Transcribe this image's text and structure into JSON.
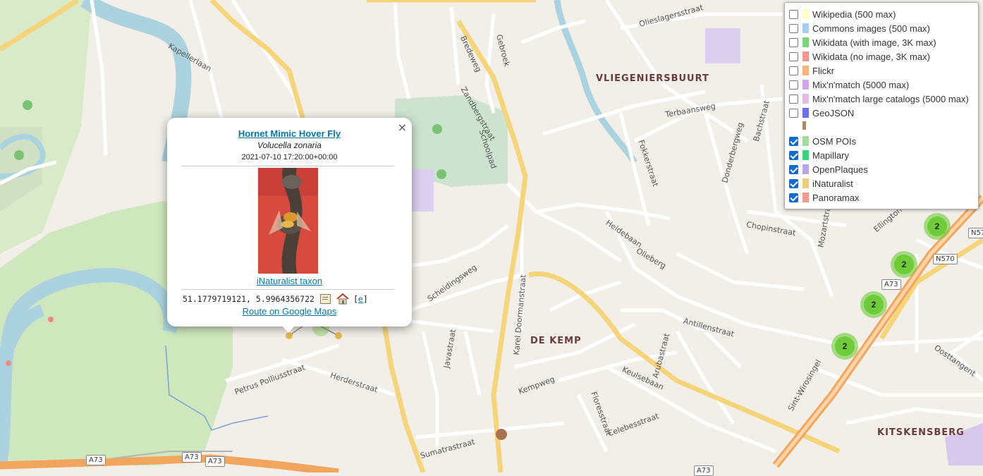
{
  "map": {
    "districts": [
      "VLIEGENIERSBUURT",
      "DE KEMP",
      "KITSKENSBERG"
    ],
    "streets": [
      "Kapellerlaan",
      "Bredeweg",
      "Gebroek",
      "Zandbergstraat",
      "Schoolpad",
      "Olieslagersstraat",
      "Terbaansweg",
      "Fokkerstraat",
      "Donderbergweg",
      "Bachstraat",
      "Heidebaan",
      "Olieberg",
      "Chopinstraat",
      "Mozartstraat",
      "Ellington",
      "Scheidingsweg",
      "Karel Doormanstraat",
      "Javastraat",
      "Antillenstraat",
      "Arubastraat",
      "Kempweg",
      "Keulsebaan",
      "Floresstraat",
      "Celebesstraat",
      "Sumatrastraat",
      "Petrus Polliusstraat",
      "Herderstraat",
      "Sint-Wirosingel",
      "Oosttangent"
    ],
    "road_shields": [
      "A73",
      "A73",
      "A73",
      "A73",
      "A73",
      "N570",
      "N57"
    ],
    "clusters": [
      "2",
      "2",
      "2",
      "2"
    ]
  },
  "layers": [
    {
      "label": "Wikipedia (500 max)",
      "checked": false,
      "color": "#ffffcc"
    },
    {
      "label": "Commons images (500 max)",
      "checked": false,
      "color": "#a9cdf5"
    },
    {
      "label": "Wikidata (with image, 3K max)",
      "checked": false,
      "color": "#7ed37c"
    },
    {
      "label": "Wikidata (no image, 3K max)",
      "checked": false,
      "color": "#f39591"
    },
    {
      "label": "Flickr",
      "checked": false,
      "color": "#f5b57c"
    },
    {
      "label": "Mix'n'match (5000 max)",
      "checked": false,
      "color": "#cfa7ea"
    },
    {
      "label": "Mix'n'match large catalogs (5000 max)",
      "checked": false,
      "color": "#e2bce0"
    },
    {
      "label": "GeoJSON",
      "checked": false,
      "color": "#6f6ff5"
    },
    {
      "label": "OSM POIs",
      "checked": true,
      "color": "#a3d9a3"
    },
    {
      "label": "Mapillary",
      "checked": true,
      "color": "#3bd27a"
    },
    {
      "label": "OpenPlaques",
      "checked": true,
      "color": "#b8a6e6"
    },
    {
      "label": "iNaturalist",
      "checked": true,
      "color": "#e9cc7c"
    },
    {
      "label": "Panoramax",
      "checked": true,
      "color": "#f19a8e"
    }
  ],
  "popup": {
    "title": "Hornet Mimic Hover Fly",
    "scientific_name": "Volucella zonaria",
    "date": "2021-07-10 17:20:00+00:00",
    "taxon_link": "iNaturalist taxon",
    "coordinates": "51.1779719121, 5.9964356722",
    "edit_label": "e",
    "route_link": "Route on Google Maps",
    "close_label": "×"
  }
}
